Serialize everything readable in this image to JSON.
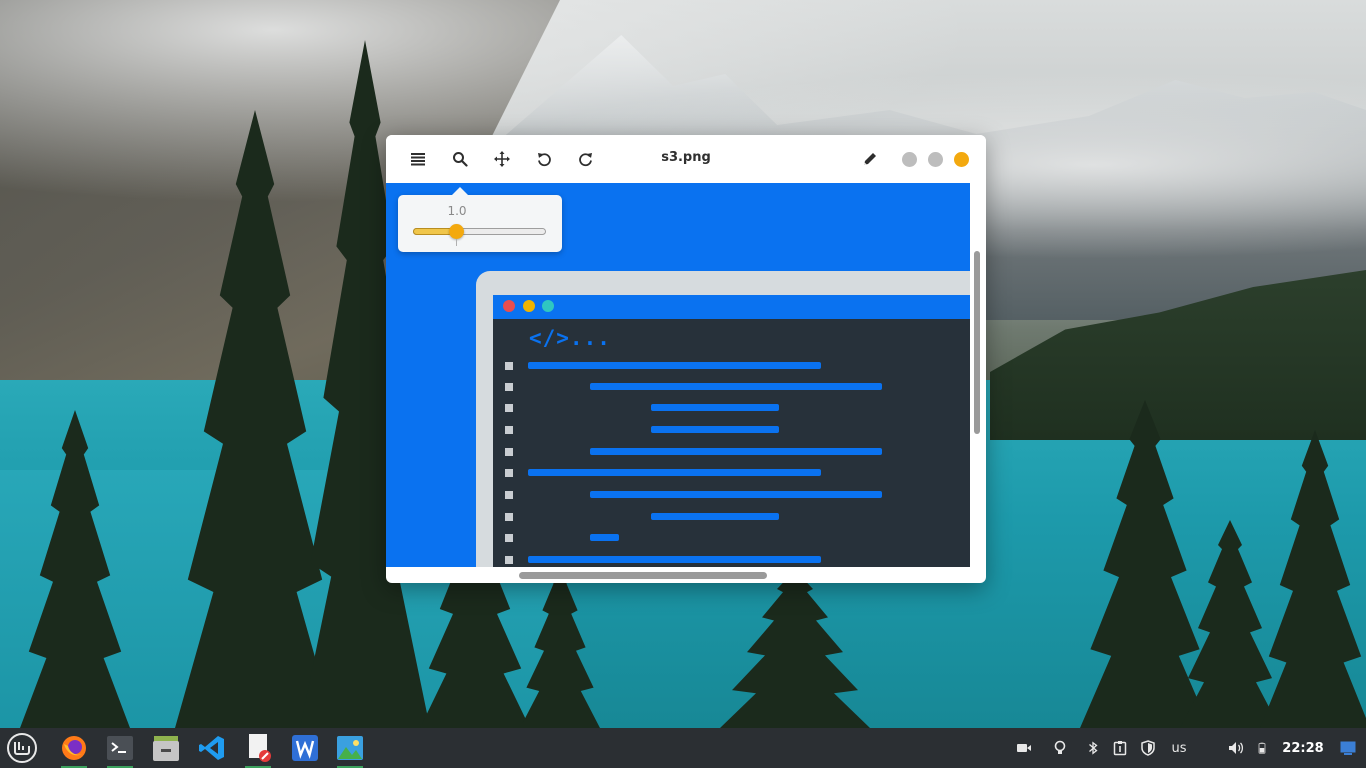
{
  "window": {
    "title": "s3.png",
    "menu_icon": "hamburger-menu-icon",
    "zoom_icon": "magnifier-icon",
    "move_icon": "move-arrows-icon",
    "rotate_left_icon": "rotate-left-icon",
    "rotate_right_icon": "rotate-right-icon",
    "edit_icon": "pencil-icon",
    "controls": {
      "minimize_color": "#bdbdbd",
      "maximize_color": "#bdbdbd",
      "close_color": "#f3a90f"
    }
  },
  "zoom_popover": {
    "value": "1.0",
    "slider_level": 0.32,
    "accent_color": "#f3a90f"
  },
  "image": {
    "background_color": "#0a72f0",
    "code_tag": "</>...",
    "dots": [
      "#e84e4e",
      "#f0b400",
      "#2fc7c1"
    ]
  },
  "taskbar": {
    "apps": [
      {
        "name": "menu-icon",
        "label": "Linux Mint menu"
      },
      {
        "name": "firefox-icon",
        "label": "Firefox"
      },
      {
        "name": "terminal-icon",
        "label": "Terminal"
      },
      {
        "name": "file-manager-icon",
        "label": "Files"
      },
      {
        "name": "vscode-icon",
        "label": "Visual Studio Code"
      },
      {
        "name": "document-editor-icon",
        "label": "Editor"
      },
      {
        "name": "wps-writer-icon",
        "label": "WPS Writer"
      },
      {
        "name": "image-viewer-icon",
        "label": "Image Viewer"
      }
    ],
    "tray": {
      "camera_icon": "video-camera-icon",
      "bulb_icon": "light-bulb-icon",
      "bluetooth_icon": "bluetooth-icon",
      "clipboard_icon": "clipboard-icon",
      "shield_icon": "shield-icon",
      "keyboard_layout": "us",
      "wifi_icon": "wifi-icon",
      "volume_icon": "volume-icon",
      "battery_icon": "battery-icon",
      "clock": "22:28",
      "desktop_icon": "show-desktop-icon"
    }
  }
}
